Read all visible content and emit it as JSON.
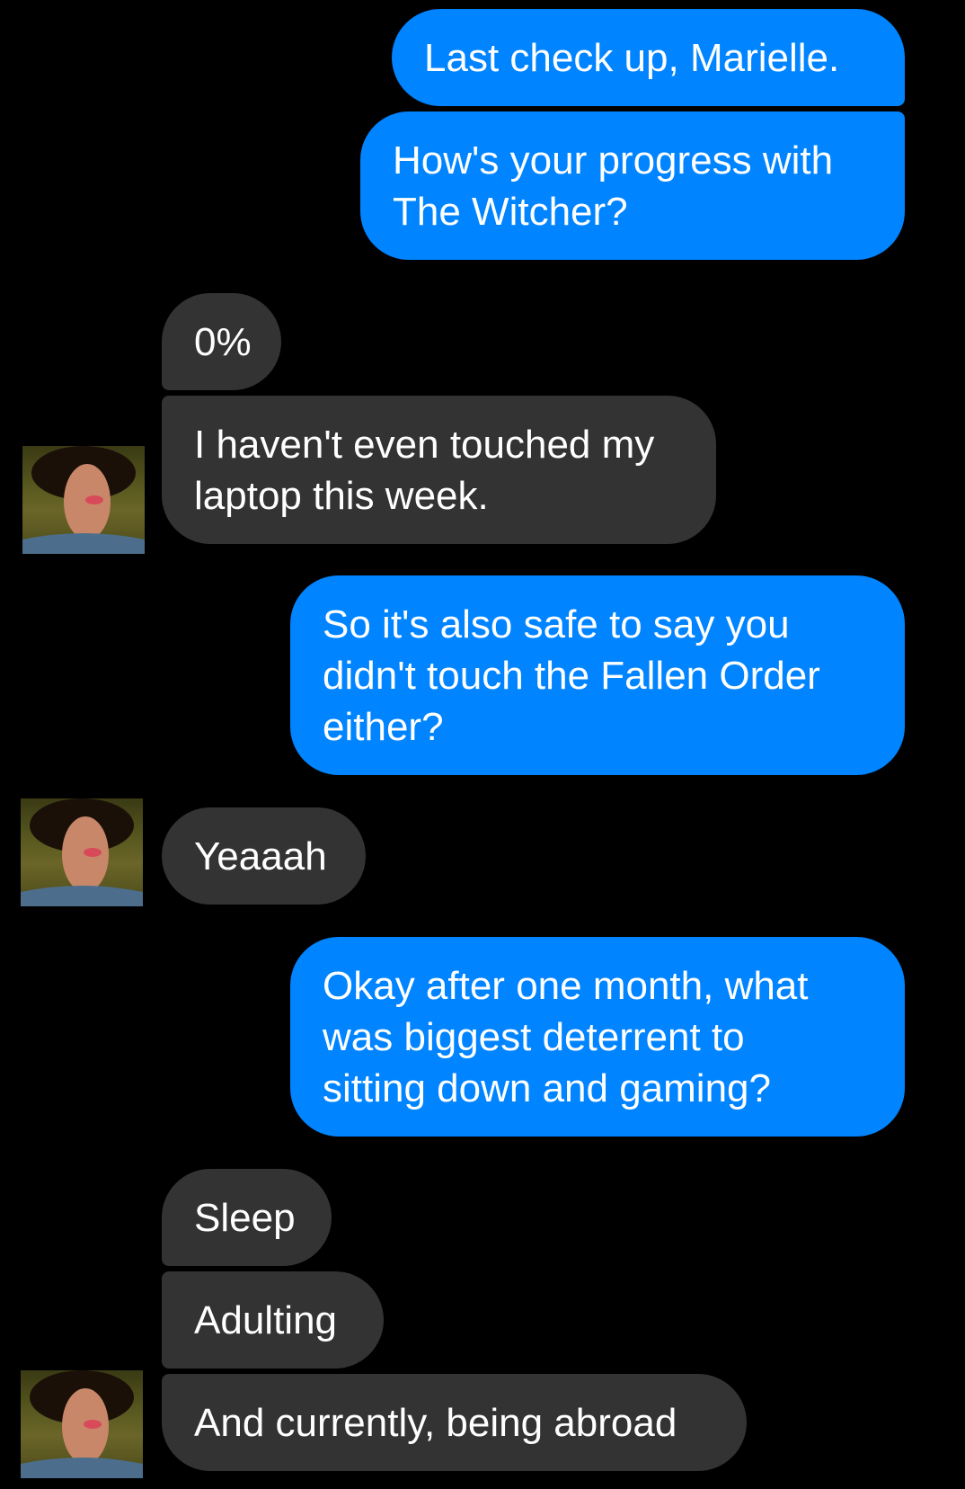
{
  "messages": [
    {
      "sender": "me",
      "text": "Last check up, Marielle."
    },
    {
      "sender": "me",
      "text": "How's your progress with\nThe Witcher?"
    },
    {
      "sender": "them",
      "text": "0%"
    },
    {
      "sender": "them",
      "text": "I haven't even touched my\nlaptop this week."
    },
    {
      "sender": "me",
      "text": "So it's also safe to say you\ndidn't touch the Fallen Order\neither?"
    },
    {
      "sender": "them",
      "text": "Yeaaah"
    },
    {
      "sender": "me",
      "text": "Okay after one month, what\nwas biggest deterrent to\nsitting down and gaming?"
    },
    {
      "sender": "them",
      "text": "Sleep"
    },
    {
      "sender": "them",
      "text": "Adulting"
    },
    {
      "sender": "them",
      "text": "And currently, being abroad"
    }
  ],
  "colors": {
    "background": "#000000",
    "sent_bubble": "#0084ff",
    "received_bubble": "#333333",
    "text": "#ffffff"
  }
}
